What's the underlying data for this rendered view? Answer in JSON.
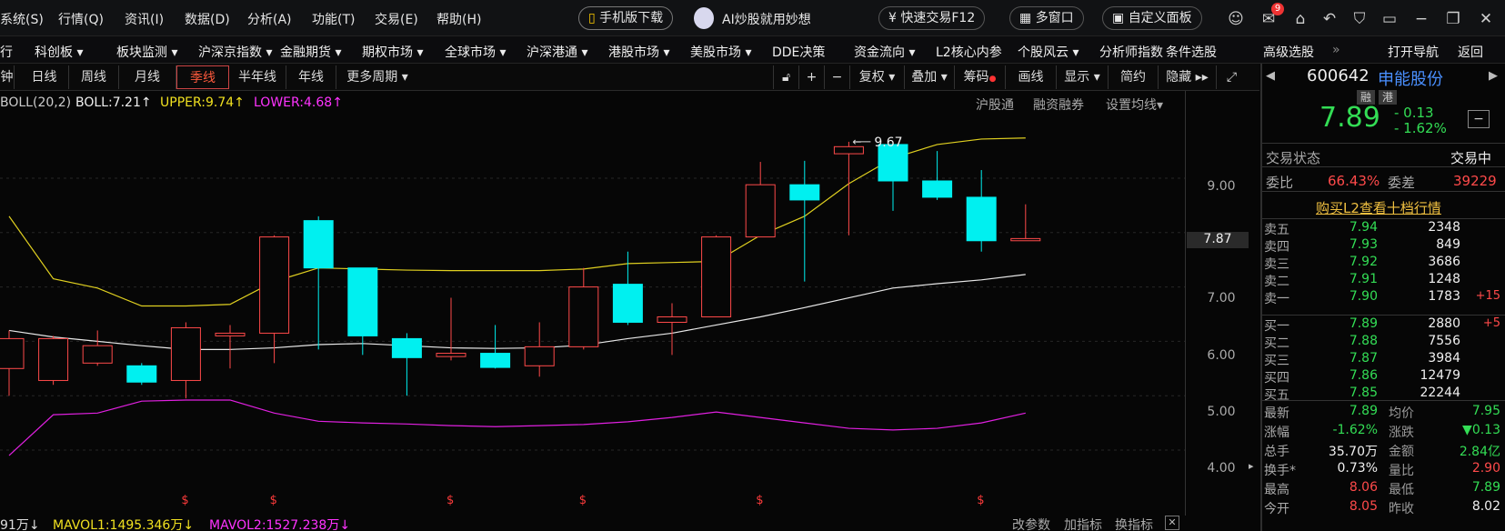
{
  "menu": [
    "系统(S)",
    "行情(Q)",
    "资讯(I)",
    "数据(D)",
    "分析(A)",
    "功能(T)",
    "交易(E)",
    "帮助(H)"
  ],
  "top": {
    "mobile": "手机版下载",
    "ai": "AI炒股就用妙想",
    "fast_trade": "快速交易F12",
    "multi_window": "多窗口",
    "custom_panel": "自定义面板",
    "mail_badge": "9"
  },
  "nav": [
    "行",
    "科创板",
    "板块监测",
    "沪深京指数",
    "金融期货",
    "期权市场",
    "全球市场",
    "沪深港通",
    "港股市场",
    "美股市场",
    "DDE决策",
    "资金流向",
    "L2核心内参",
    "个股风云",
    "分析师指数",
    "条件选股",
    "高级选股",
    "»",
    "打开导航",
    "返回"
  ],
  "periods": [
    "钟",
    "日线",
    "周线",
    "月线",
    "季线",
    "半年线",
    "年线",
    "更多周期"
  ],
  "active_period": "季线",
  "tools": [
    "复权",
    "叠加",
    "筹码",
    "画线",
    "显示",
    "简约",
    "隐藏"
  ],
  "indicator": {
    "name": "BOLL(20,2)",
    "boll": "BOLL:7.21",
    "upper": "UPPER:9.74",
    "lower": "LOWER:4.68"
  },
  "links": [
    "沪股通",
    "融资融券",
    "设置均线"
  ],
  "yaxis": [
    "9.00",
    "8.00",
    "7.00",
    "6.00",
    "5.00",
    "4.00"
  ],
  "current_price_tag": "7.87",
  "high_label": "9.67",
  "chart_data": {
    "type": "candlestick",
    "ylim": [
      3.7,
      10.0
    ],
    "candles": [
      {
        "o": 5.5,
        "c": 6.05,
        "h": 6.2,
        "l": 5.0
      },
      {
        "o": 5.28,
        "c": 6.05,
        "h": 6.1,
        "l": 5.2
      },
      {
        "o": 5.6,
        "c": 5.92,
        "h": 6.2,
        "l": 5.55
      },
      {
        "o": 5.55,
        "c": 5.25,
        "h": 5.6,
        "l": 5.2
      },
      {
        "o": 5.28,
        "c": 6.25,
        "h": 6.35,
        "l": 4.95
      },
      {
        "o": 6.1,
        "c": 6.15,
        "h": 6.3,
        "l": 5.5
      },
      {
        "o": 6.15,
        "c": 7.92,
        "h": 7.95,
        "l": 5.6
      },
      {
        "o": 8.22,
        "c": 7.35,
        "h": 8.3,
        "l": 5.85
      },
      {
        "o": 7.35,
        "c": 6.1,
        "h": 7.35,
        "l": 5.75
      },
      {
        "o": 6.05,
        "c": 5.7,
        "h": 6.15,
        "l": 5.0
      },
      {
        "o": 5.72,
        "c": 5.78,
        "h": 6.8,
        "l": 5.65
      },
      {
        "o": 5.78,
        "c": 5.52,
        "h": 6.3,
        "l": 5.5
      },
      {
        "o": 5.55,
        "c": 5.9,
        "h": 6.35,
        "l": 5.35
      },
      {
        "o": 5.9,
        "c": 7.0,
        "h": 7.35,
        "l": 5.85
      },
      {
        "o": 7.05,
        "c": 6.35,
        "h": 7.65,
        "l": 6.3
      },
      {
        "o": 6.35,
        "c": 6.45,
        "h": 6.7,
        "l": 5.75
      },
      {
        "o": 6.45,
        "c": 7.92,
        "h": 7.95,
        "l": 6.45
      },
      {
        "o": 7.92,
        "c": 8.88,
        "h": 9.3,
        "l": 7.92
      },
      {
        "o": 8.88,
        "c": 8.6,
        "h": 9.32,
        "l": 7.1
      },
      {
        "o": 9.45,
        "c": 9.58,
        "h": 9.67,
        "l": 7.95
      },
      {
        "o": 9.62,
        "c": 8.95,
        "h": 9.62,
        "l": 8.4
      },
      {
        "o": 8.95,
        "c": 8.65,
        "h": 9.5,
        "l": 8.6
      },
      {
        "o": 8.65,
        "c": 7.85,
        "h": 9.15,
        "l": 7.65
      },
      {
        "o": 7.85,
        "c": 7.89,
        "h": 8.52,
        "l": 7.85
      }
    ],
    "boll_mid": [
      6.2,
      6.08,
      6.0,
      5.92,
      5.85,
      5.85,
      5.88,
      5.94,
      5.96,
      5.92,
      5.88,
      5.87,
      5.88,
      5.93,
      6.05,
      6.15,
      6.3,
      6.45,
      6.62,
      6.8,
      6.98,
      7.06,
      7.13,
      7.23
    ],
    "boll_upper": [
      8.3,
      7.15,
      6.98,
      6.65,
      6.65,
      6.68,
      7.1,
      7.35,
      7.33,
      7.31,
      7.3,
      7.3,
      7.3,
      7.33,
      7.43,
      7.45,
      7.47,
      7.95,
      8.3,
      8.9,
      9.37,
      9.62,
      9.72,
      9.74
    ],
    "boll_lower": [
      3.9,
      4.65,
      4.68,
      4.9,
      4.92,
      4.92,
      4.68,
      4.53,
      4.5,
      4.48,
      4.45,
      4.43,
      4.45,
      4.47,
      4.52,
      4.6,
      4.7,
      4.6,
      4.5,
      4.4,
      4.37,
      4.4,
      4.5,
      4.68
    ]
  },
  "bottom": {
    "vol": "91万",
    "mavol1": "MAVOL1:1495.346万",
    "mavol2": "MAVOL2:1527.238万",
    "params": "改参数",
    "add_ind": "加指标",
    "switch_ind": "换指标"
  },
  "quote": {
    "code": "600642",
    "name": "申能股份",
    "tag1": "融",
    "tag2": "港",
    "price": "7.89",
    "change": "- 0.13",
    "change_pct": "- 1.62%",
    "status_label": "交易状态",
    "status": "交易中",
    "weibi_label": "委比",
    "weibi": "66.43%",
    "weicha_label": "委差",
    "weicha": "39229",
    "l2_link": "购买L2查看十档行情",
    "asks": [
      {
        "l": "卖五",
        "p": "7.94",
        "v": "2348",
        "d": ""
      },
      {
        "l": "卖四",
        "p": "7.93",
        "v": "849",
        "d": ""
      },
      {
        "l": "卖三",
        "p": "7.92",
        "v": "3686",
        "d": ""
      },
      {
        "l": "卖二",
        "p": "7.91",
        "v": "1248",
        "d": ""
      },
      {
        "l": "卖一",
        "p": "7.90",
        "v": "1783",
        "d": "+15"
      }
    ],
    "bids": [
      {
        "l": "买一",
        "p": "7.89",
        "v": "2880",
        "d": "+5"
      },
      {
        "l": "买二",
        "p": "7.88",
        "v": "7556",
        "d": ""
      },
      {
        "l": "买三",
        "p": "7.87",
        "v": "3984",
        "d": ""
      },
      {
        "l": "买四",
        "p": "7.86",
        "v": "12479",
        "d": ""
      },
      {
        "l": "买五",
        "p": "7.85",
        "v": "22244",
        "d": ""
      }
    ],
    "stats": [
      {
        "l1": "最新",
        "v1": "7.89",
        "c1": "green",
        "l2": "均价",
        "v2": "7.95",
        "c2": "green"
      },
      {
        "l1": "涨幅",
        "v1": "-1.62%",
        "c1": "green",
        "l2": "涨跌",
        "v2": "▼0.13",
        "c2": "green"
      },
      {
        "l1": "总手",
        "v1": "35.70万",
        "c1": "white",
        "l2": "金额",
        "v2": "2.84亿",
        "c2": "green"
      },
      {
        "l1": "换手*",
        "v1": "0.73%",
        "c1": "white",
        "l2": "量比",
        "v2": "2.90",
        "c2": "red"
      },
      {
        "l1": "最高",
        "v1": "8.06",
        "c1": "red",
        "l2": "最低",
        "v2": "7.89",
        "c2": "green"
      },
      {
        "l1": "今开",
        "v1": "8.05",
        "c1": "red",
        "l2": "昨收",
        "v2": "8.02",
        "c2": "white"
      }
    ]
  }
}
